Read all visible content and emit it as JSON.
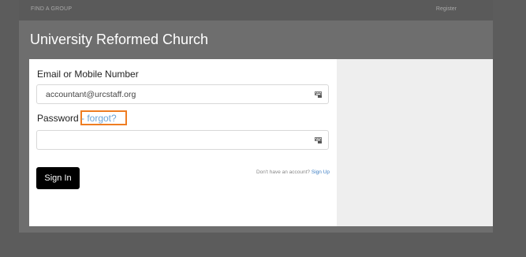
{
  "nav": {
    "find_group": "FIND A GROUP",
    "register": "Register"
  },
  "org": {
    "title": "University Reformed Church"
  },
  "login": {
    "email_label": "Email or Mobile Number",
    "email_value": "accountant@urcstaff.org",
    "password_label": "Password",
    "forgot_link": "- forgot?",
    "password_value": "",
    "sign_in_label": "Sign In",
    "no_account_text": "Don't have an account?",
    "sign_up_link": "Sign Up"
  },
  "icons": {
    "field_autofill": "keyboard-icon"
  },
  "colors": {
    "highlight": "#ef7d22",
    "link": "#3f7fc4",
    "button": "#000000"
  }
}
